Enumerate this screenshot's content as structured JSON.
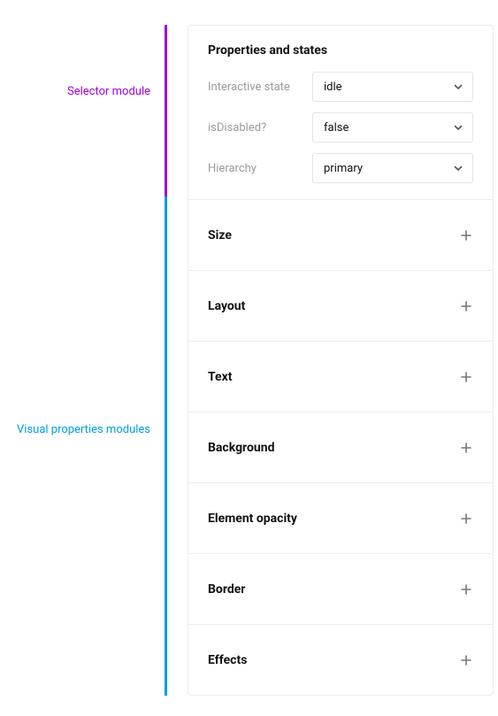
{
  "annotations": {
    "selector_label": "Selector module",
    "visual_label": "Visual properties modules"
  },
  "selector": {
    "title": "Properties and states",
    "rows": [
      {
        "label": "Interactive state",
        "value": "idle"
      },
      {
        "label": "isDisabled?",
        "value": "false"
      },
      {
        "label": "Hierarchy",
        "value": "primary"
      }
    ]
  },
  "visual_sections": [
    {
      "label": "Size"
    },
    {
      "label": "Layout"
    },
    {
      "label": "Text"
    },
    {
      "label": "Background"
    },
    {
      "label": "Element opacity"
    },
    {
      "label": "Border"
    },
    {
      "label": "Effects"
    }
  ],
  "colors": {
    "selector_accent": "#a100d8",
    "visual_accent": "#009de0"
  }
}
